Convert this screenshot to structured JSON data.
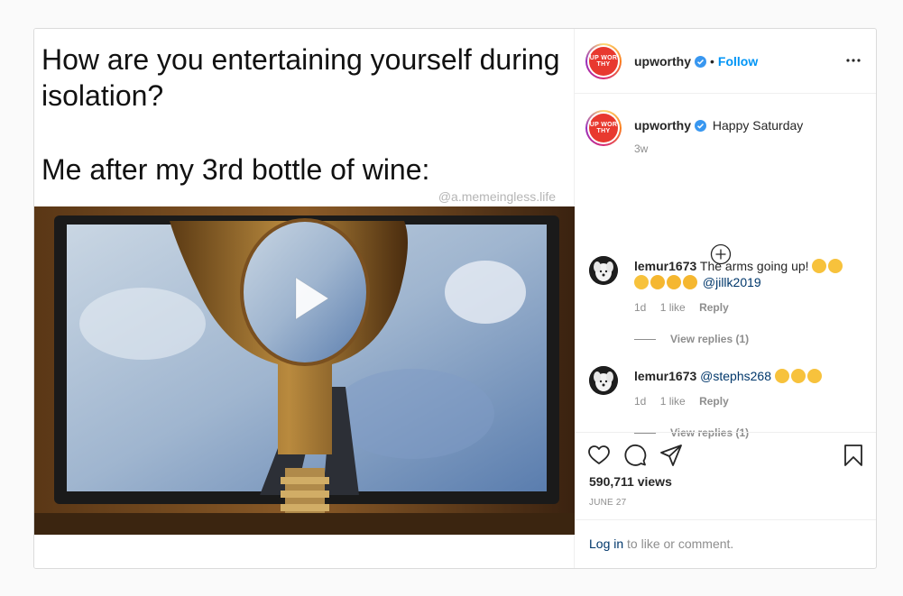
{
  "media": {
    "meme_line1": "How are you entertaining yourself during",
    "meme_line2": "isolation?",
    "meme_line3": "Me after my 3rd bottle of wine:",
    "watermark": "@a.memeingless.life",
    "play_icon": "play-icon"
  },
  "header": {
    "avatar_logo": "UP WOR THY",
    "username": "upworthy",
    "separator": "•",
    "follow_label": "Follow",
    "more_icon": "more-options-icon"
  },
  "caption": {
    "username": "upworthy",
    "text": "Happy Saturday",
    "time": "3w"
  },
  "comments": [
    {
      "username": "lemur1673",
      "text": "The arms going up!",
      "emoji_line1_count": 2,
      "emoji_line2_count": 4,
      "mention": "@jillk2019",
      "time": "1d",
      "likes": "1 like",
      "reply": "Reply",
      "view_replies": "View replies (1)"
    },
    {
      "username": "lemur1673",
      "mention": "@stephs268",
      "emoji_count": 3,
      "time": "1d",
      "likes": "1 like",
      "reply": "Reply",
      "view_replies": "View replies (1)"
    }
  ],
  "stats": {
    "views": "590,711 views",
    "date": "JUNE 27"
  },
  "login": {
    "link": "Log in",
    "text": "to like or comment."
  },
  "colors": {
    "accent": "#0095f6",
    "brand": "#e8392f",
    "muted": "#8e8e8e"
  }
}
